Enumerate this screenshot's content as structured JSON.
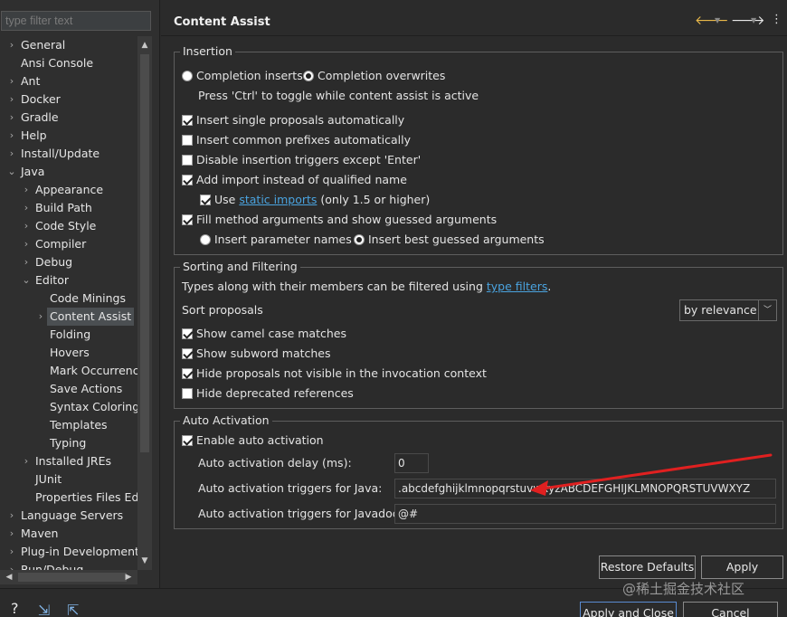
{
  "left": {
    "filter_placeholder": "type filter text",
    "tree": [
      {
        "label": "General",
        "depth": 0,
        "twisty": "›"
      },
      {
        "label": "Ansi Console",
        "depth": 0,
        "twisty": ""
      },
      {
        "label": "Ant",
        "depth": 0,
        "twisty": "›"
      },
      {
        "label": "Docker",
        "depth": 0,
        "twisty": "›"
      },
      {
        "label": "Gradle",
        "depth": 0,
        "twisty": "›"
      },
      {
        "label": "Help",
        "depth": 0,
        "twisty": "›"
      },
      {
        "label": "Install/Update",
        "depth": 0,
        "twisty": "›"
      },
      {
        "label": "Java",
        "depth": 0,
        "twisty": "⌄"
      },
      {
        "label": "Appearance",
        "depth": 1,
        "twisty": "›"
      },
      {
        "label": "Build Path",
        "depth": 1,
        "twisty": "›"
      },
      {
        "label": "Code Style",
        "depth": 1,
        "twisty": "›"
      },
      {
        "label": "Compiler",
        "depth": 1,
        "twisty": "›"
      },
      {
        "label": "Debug",
        "depth": 1,
        "twisty": "›"
      },
      {
        "label": "Editor",
        "depth": 1,
        "twisty": "⌄"
      },
      {
        "label": "Code Minings",
        "depth": 2,
        "twisty": ""
      },
      {
        "label": "Content Assist",
        "depth": 2,
        "twisty": "›",
        "selected": true
      },
      {
        "label": "Folding",
        "depth": 2,
        "twisty": ""
      },
      {
        "label": "Hovers",
        "depth": 2,
        "twisty": ""
      },
      {
        "label": "Mark Occurrence",
        "depth": 2,
        "twisty": ""
      },
      {
        "label": "Save Actions",
        "depth": 2,
        "twisty": ""
      },
      {
        "label": "Syntax Coloring",
        "depth": 2,
        "twisty": ""
      },
      {
        "label": "Templates",
        "depth": 2,
        "twisty": ""
      },
      {
        "label": "Typing",
        "depth": 2,
        "twisty": ""
      },
      {
        "label": "Installed JREs",
        "depth": 1,
        "twisty": "›"
      },
      {
        "label": "JUnit",
        "depth": 1,
        "twisty": ""
      },
      {
        "label": "Properties Files Edi",
        "depth": 1,
        "twisty": ""
      },
      {
        "label": "Language Servers",
        "depth": 0,
        "twisty": "›"
      },
      {
        "label": "Maven",
        "depth": 0,
        "twisty": "›"
      },
      {
        "label": "Plug-in Development",
        "depth": 0,
        "twisty": "›"
      },
      {
        "label": "Run/Debug",
        "depth": 0,
        "twisty": "›"
      }
    ]
  },
  "header": {
    "title": "Content Assist"
  },
  "insertion": {
    "legend": "Insertion",
    "completion_inserts": "Completion inserts",
    "completion_overwrites": "Completion overwrites",
    "toggle_hint": "Press 'Ctrl' to toggle while content assist is active",
    "single_proposals": "Insert single proposals automatically",
    "common_prefixes": "Insert common prefixes automatically",
    "disable_triggers": "Disable insertion triggers except 'Enter'",
    "add_import": "Add import instead of qualified name",
    "use_label": "Use",
    "static_imports": "static imports",
    "static_suffix": "(only 1.5 or higher)",
    "fill_args": "Fill method arguments and show guessed arguments",
    "param_names": "Insert parameter names",
    "best_guessed": "Insert best guessed arguments"
  },
  "sorting": {
    "legend": "Sorting and Filtering",
    "types_prefix": "Types along with their members can be filtered using",
    "type_filters": "type filters",
    "types_suffix": ".",
    "sort_label": "Sort proposals",
    "sort_value": "by relevance",
    "camel": "Show camel case matches",
    "subword": "Show subword matches",
    "hide_invisible": "Hide proposals not visible in the invocation context",
    "hide_deprecated": "Hide deprecated references"
  },
  "auto": {
    "legend": "Auto Activation",
    "enable": "Enable auto activation",
    "delay_label": "Auto activation delay (ms):",
    "delay_value": "0",
    "java_label": "Auto activation triggers for Java:",
    "java_value": ".abcdefghijklmnopqrstuvwxyzABCDEFGHIJKLMNOPQRSTUVWXYZ",
    "javadoc_label": "Auto activation triggers for Javadoc:",
    "javadoc_value": "@#"
  },
  "buttons": {
    "restore": "Restore Defaults",
    "apply": "Apply",
    "apply_close": "Apply and Close",
    "cancel": "Cancel"
  },
  "watermark": "@稀土掘金技术社区",
  "colors": {
    "annotation_arrow": "#e02020",
    "link": "#4aa3df"
  }
}
